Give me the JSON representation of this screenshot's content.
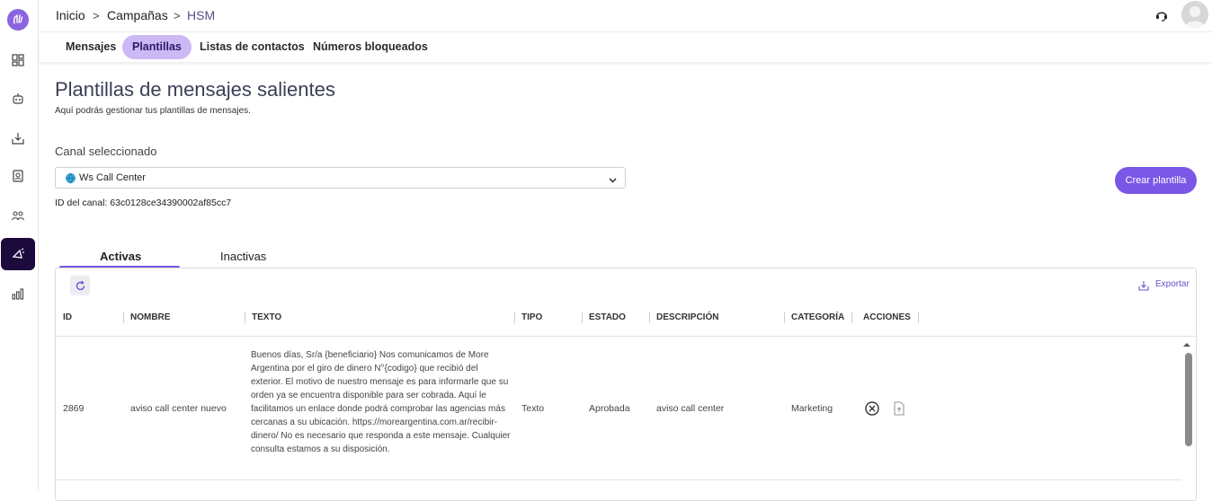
{
  "breadcrumb": {
    "home": "Inicio",
    "campaigns": "Campañas",
    "current": "HSM",
    "sep": ">"
  },
  "subnav": {
    "tabs": [
      "Mensajes",
      "Plantillas",
      "Listas de contactos",
      "Números bloqueados"
    ]
  },
  "page": {
    "title": "Plantillas de mensajes salientes",
    "subtitle": "Aquí podrás gestionar tus plantillas de mensajes.",
    "channel_label": "Canal seleccionado",
    "channel_value": "Ws Call Center",
    "channel_id": "ID del canal: 63c0128ce34390002af85cc7",
    "create_button": "Crear plantilla"
  },
  "tabs": {
    "active": "Activas",
    "inactive": "Inactivas"
  },
  "table": {
    "export_label": "Exportar",
    "columns": [
      "ID",
      "NOMBRE",
      "TEXTO",
      "TIPO",
      "ESTADO",
      "DESCRIPCIÓN",
      "CATEGORÍA",
      "ACCIONES"
    ],
    "rows": [
      {
        "id": "2869",
        "name": "aviso call center nuevo",
        "text": "Buenos días, Sr/a {beneficiario} Nos comunicamos de More Argentina por el giro de dinero N°{codigo} que recibió del exterior. El motivo de nuestro mensaje es para informarle que su orden ya se encuentra disponible para ser cobrada. Aquí le facilitamos un enlace donde podrá comprobar las agencias más cercanas a su ubicación. https://moreargentina.com.ar/recibir-dinero/ No es necesario que responda a este mensaje. Cualquier consulta estamos a su disposición.",
        "type": "Texto",
        "status": "Aprobada",
        "description": "aviso call center",
        "category": "Marketing"
      }
    ]
  },
  "colors": {
    "accent": "#7a57e6",
    "active_tab_bg": "#cbb8f5",
    "sidebar_active": "#1d0a3d"
  }
}
